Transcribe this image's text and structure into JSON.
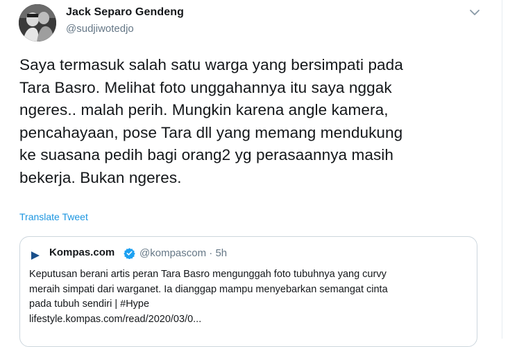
{
  "tweet": {
    "author_name": "Jack Separo Gendeng",
    "author_handle": "@sudjiwotedjo",
    "body_lines": [
      "Saya termasuk salah satu warga yang bersimpati pada",
      "Tara Basro. Melihat foto unggahannya itu saya nggak",
      "ngeres.. malah perih. Mungkin karena angle kamera,",
      "pencahayaan, pose Tara dll yang memang mendukung",
      "ke suasana pedih bagi orang2 yg perasaannya masih",
      "bekerja. Bukan ngeres."
    ],
    "translate_label": "Translate Tweet",
    "menu_icon": "chevron-down-icon"
  },
  "quoted": {
    "name": "Kompas.com",
    "verified_icon": "verified-badge-icon",
    "handle": "@kompascom",
    "separator": "·",
    "time": "5h",
    "text_lines": [
      "Keputusan berani artis peran Tara Basro mengunggah foto tubuhnya yang curvy",
      "meraih simpati dari warganet. Ia dianggap mampu menyebarkan semangat cinta",
      "pada tubuh sendiri | #Hype",
      "lifestyle.kompas.com/read/2020/03/0..."
    ]
  },
  "colors": {
    "link": "#1b95e0",
    "verified": "#1da1f2",
    "secondary_text": "#657786",
    "border": "#ccd6dd"
  }
}
